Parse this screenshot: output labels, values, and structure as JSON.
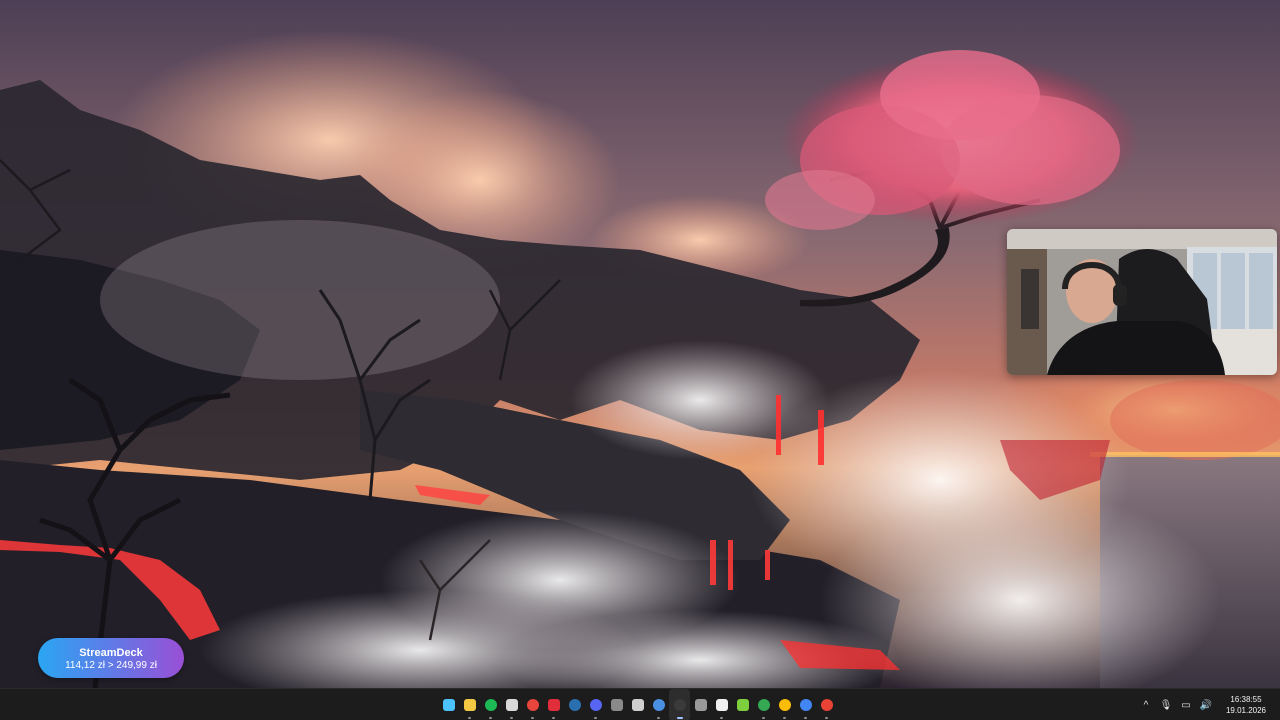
{
  "overlay": {
    "donation_title": "StreamDeck",
    "donation_current": "114,12 zł",
    "donation_separator": ">",
    "donation_goal": "249,99 zł"
  },
  "taskbar": {
    "apps": [
      {
        "icon": "windows-start-icon",
        "color": "#4cc2ff",
        "active": false,
        "open": false
      },
      {
        "icon": "file-explorer-icon",
        "color": "#f3c843",
        "active": false,
        "open": true
      },
      {
        "icon": "spotify-icon",
        "color": "#1db954",
        "active": false,
        "open": true
      },
      {
        "icon": "grid-app-icon",
        "color": "#d9d9d9",
        "active": false,
        "open": true
      },
      {
        "icon": "chrome-icon",
        "color": "#e8453c",
        "active": false,
        "open": true
      },
      {
        "icon": "red-app-icon",
        "color": "#e02f3a",
        "active": false,
        "open": true
      },
      {
        "icon": "steam-icon",
        "color": "#2a6fb0",
        "active": false,
        "open": false
      },
      {
        "icon": "discord-icon",
        "color": "#5865f2",
        "active": false,
        "open": true
      },
      {
        "icon": "epic-games-icon",
        "color": "#8a8a8a",
        "active": false,
        "open": false
      },
      {
        "icon": "streamlabs-icon",
        "color": "#cfcfcf",
        "active": false,
        "open": false
      },
      {
        "icon": "blue-circle-app-icon",
        "color": "#4a90e2",
        "active": false,
        "open": true
      },
      {
        "icon": "obs-icon",
        "color": "#3a3a3a",
        "active": true,
        "open": true
      },
      {
        "icon": "bitwarden-icon",
        "color": "#9a9a9a",
        "active": false,
        "open": false
      },
      {
        "icon": "white-square-app-icon",
        "color": "#f0f0f0",
        "active": false,
        "open": true
      },
      {
        "icon": "green-app-icon",
        "color": "#7dcf3e",
        "active": false,
        "open": false
      },
      {
        "icon": "chrome-profile-2-icon",
        "color": "#34a853",
        "active": false,
        "open": true
      },
      {
        "icon": "chrome-profile-3-icon",
        "color": "#fbbc05",
        "active": false,
        "open": true
      },
      {
        "icon": "chrome-profile-4-icon",
        "color": "#4285f4",
        "active": false,
        "open": true
      },
      {
        "icon": "chrome-profile-5-icon",
        "color": "#ea4335",
        "active": false,
        "open": true
      }
    ],
    "tray": {
      "chevron_icon": "^",
      "mic_icon": "🎙",
      "monitor_icon": "▭",
      "volume_icon": "🔊"
    },
    "clock_time": "16:38:55",
    "clock_date": "19.01.2026"
  }
}
